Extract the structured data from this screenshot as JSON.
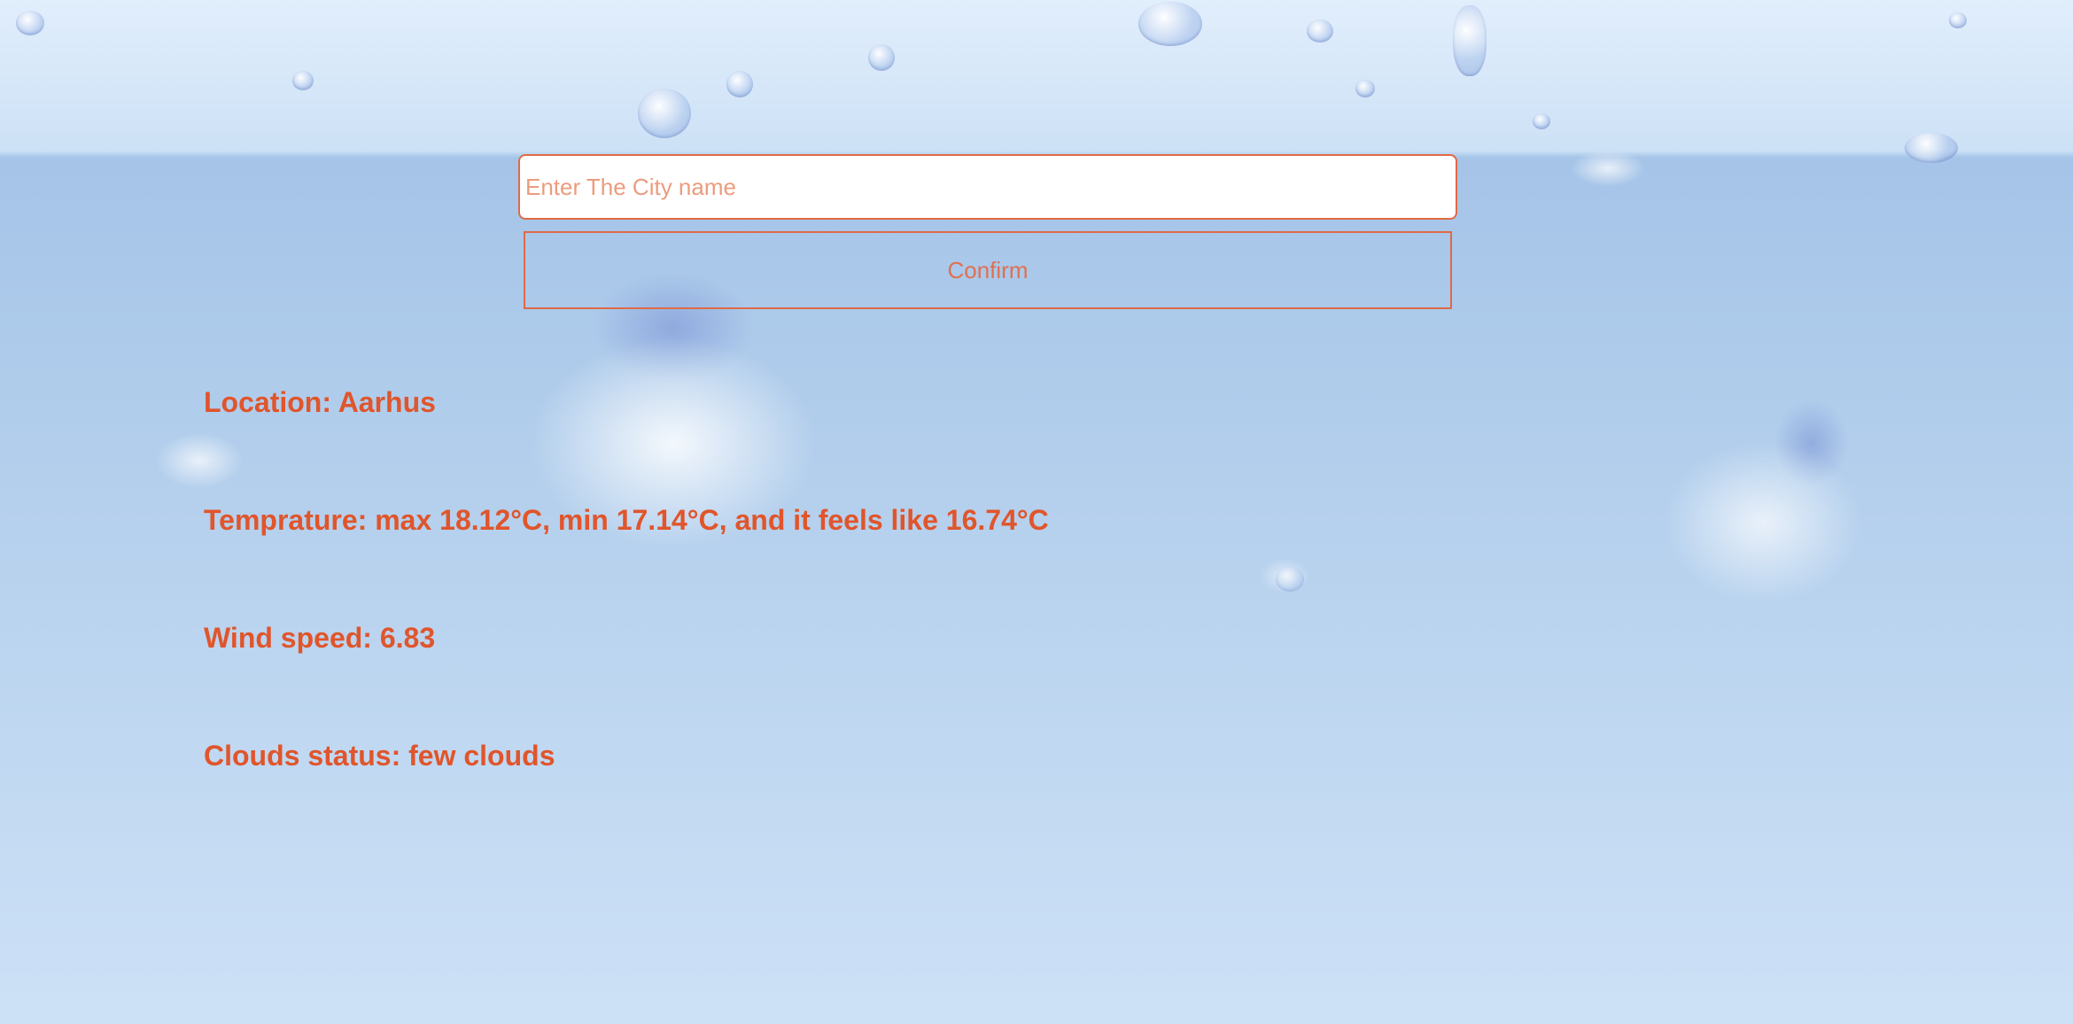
{
  "search": {
    "placeholder": "Enter The City name",
    "value": ""
  },
  "confirm_button": {
    "label": "Confirm"
  },
  "weather": {
    "location": "Location: Aarhus",
    "temperature": "Temprature: max 18.12°C, min 17.14°C, and it feels like 16.74°C",
    "wind_speed": "Wind speed: 6.83",
    "clouds_status": "Clouds status: few clouds"
  },
  "colors": {
    "accent": "#e0552b",
    "input_border": "#e06a45",
    "background_top": "#e1eefc",
    "background_bottom": "#cde1f6"
  }
}
